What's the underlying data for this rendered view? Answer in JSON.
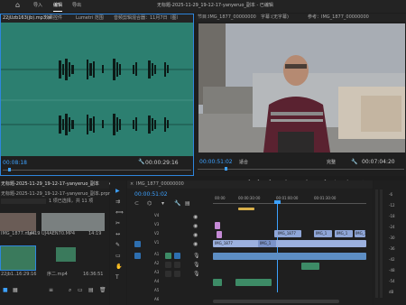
{
  "menu": {
    "home": "⌂",
    "import": "导入",
    "edit": "编辑",
    "export": "导出",
    "title": "无标题-2025-11-29_19-12-17-yanyeruo_副本 - 已编辑"
  },
  "source_tabs": [
    "22jUzb163(jb).mp3 ≡",
    "效果控件",
    "Lumetri 范围",
    "音频剪辑混合器：11月7日（图）"
  ],
  "source_time_left": "00:08:18",
  "source_time_right": "00:00:29:16",
  "program_tabs": {
    "prefix": "节目：",
    "seq": "IMG_1877_00000000",
    "caption": "字幕：",
    "caption_val": "(无字幕)",
    "ref": "参考：IMG_1877_00000000"
  },
  "program_time_left": "00:00:51:02",
  "program_fit": "适合",
  "program_quality": "完整",
  "program_time_right": "00:07:04:20",
  "project": {
    "tab": "无标题-2025-11-29_19-12-17-yanyeruo_副本",
    "path": "无标题-2025-11-29_19-12-17-yanyeruo_副本.prproj",
    "selected": "1 项已选择，共 11 项",
    "items": [
      {
        "name": "IMG_1877.mp4",
        "dur": "14:19"
      },
      {
        "name": "UJ4AEN70.MP4",
        "dur": "14:19"
      },
      {
        "name": "22jb1...",
        "dur": "16:29:16"
      },
      {
        "name": "序二.mp4",
        "dur": "16:36:51"
      }
    ]
  },
  "timeline": {
    "tab": "IMG_1877_00000000",
    "timecode": "00:00:51:02",
    "ruler": [
      "00:00",
      "00:00:30:00",
      "00:01:00:00",
      "00:01:30:00"
    ],
    "tracks": [
      {
        "name": "V4"
      },
      {
        "name": "V3"
      },
      {
        "name": "V2"
      },
      {
        "name": "V1"
      },
      {
        "name": "A1"
      },
      {
        "name": "A2"
      },
      {
        "name": "A3"
      },
      {
        "name": "A4"
      },
      {
        "name": "A5"
      },
      {
        "name": "A6"
      }
    ],
    "clips": {
      "v1a": "IMG_1877",
      "v1b": "IMG_1",
      "v1c": "IMG_1",
      "v1d": "IMG_1",
      "v1e": "IMG_1877",
      "v2a": "IMG_1"
    }
  },
  "meter_labels": [
    "-6",
    "-12",
    "-18",
    "-24",
    "-30",
    "-36",
    "-42",
    "-48",
    "-54",
    "dB"
  ],
  "colors": {
    "accent": "#2e86de",
    "waveform_bg": "#2c7f70",
    "timecode": "#3da1ff",
    "video_clip": "#8fa6d8",
    "audio_clip": "#3d8b66",
    "pink_clip": "#c58ad6"
  }
}
